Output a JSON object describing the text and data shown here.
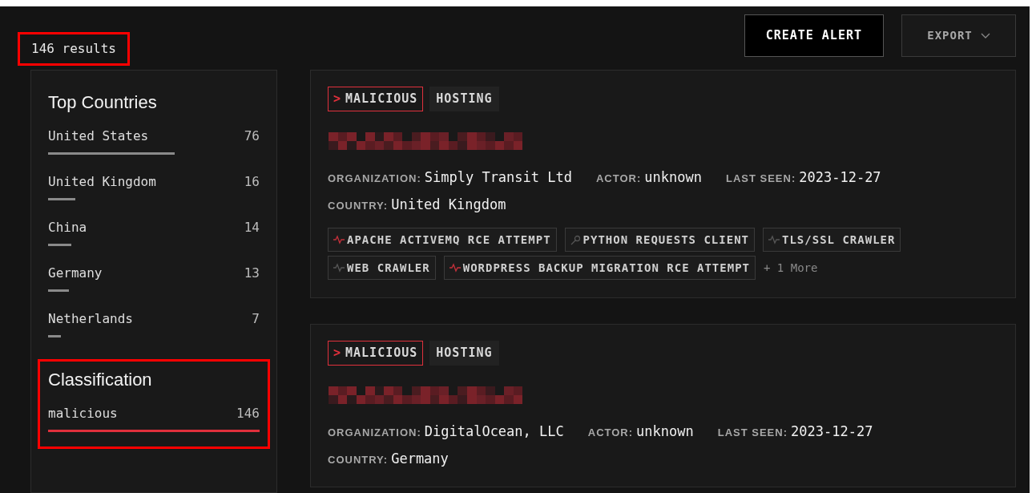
{
  "results_count": "146 results",
  "actions": [
    {
      "label": "CREATE ALERT",
      "kind": "primary"
    },
    {
      "label": "EXPORT",
      "kind": "dropdown"
    }
  ],
  "sidebar": {
    "sections": [
      {
        "title": "Top Countries",
        "highlighted": false,
        "items": [
          {
            "label": "United States",
            "count": "76",
            "level": 0.6,
            "color": "#8a8a8a"
          },
          {
            "label": "United Kingdom",
            "count": "16",
            "level": 0.13,
            "color": "#8a8a8a"
          },
          {
            "label": "China",
            "count": "14",
            "level": 0.11,
            "color": "#8a8a8a"
          },
          {
            "label": "Germany",
            "count": "13",
            "level": 0.1,
            "color": "#8a8a8a"
          },
          {
            "label": "Netherlands",
            "count": "7",
            "level": 0.06,
            "color": "#8a8a8a"
          }
        ]
      },
      {
        "title": "Classification",
        "highlighted": true,
        "items": [
          {
            "label": "malicious",
            "count": "146",
            "level": 1,
            "color": "#e0303c"
          }
        ]
      }
    ]
  },
  "results": [
    {
      "badges": [
        {
          "label": "MALICIOUS",
          "kind": "malicious",
          "prefix": ">"
        },
        {
          "label": "HOSTING",
          "kind": "plain"
        }
      ],
      "fields": [
        [
          {
            "label": "ORGANIZATION:",
            "value": "Simply Transit Ltd"
          },
          {
            "label": "ACTOR:",
            "value": "unknown"
          },
          {
            "label": "LAST SEEN:",
            "value": "2023-12-27"
          }
        ],
        [
          {
            "label": "COUNTRY:",
            "value": "United Kingdom"
          }
        ]
      ],
      "tags": [
        {
          "label": "APACHE ACTIVEMQ RCE ATTEMPT",
          "kind": "pulse",
          "color": "#c0303a"
        },
        {
          "label": "PYTHON REQUESTS CLIENT",
          "kind": "pin",
          "color": "#555555"
        },
        {
          "label": "TLS/SSL CRAWLER",
          "kind": "pulse",
          "color": "#555555"
        },
        {
          "label": "WEB CRAWLER",
          "kind": "pulse",
          "color": "#555555"
        },
        {
          "label": "WORDPRESS BACKUP MIGRATION RCE ATTEMPT",
          "kind": "pulse",
          "color": "#c0303a"
        }
      ],
      "more": "+ 1 More"
    },
    {
      "badges": [
        {
          "label": "MALICIOUS",
          "kind": "malicious",
          "prefix": ">"
        },
        {
          "label": "HOSTING",
          "kind": "plain"
        }
      ],
      "fields": [
        [
          {
            "label": "ORGANIZATION:",
            "value": "DigitalOcean, LLC"
          },
          {
            "label": "ACTOR:",
            "value": "unknown"
          },
          {
            "label": "LAST SEEN:",
            "value": "2023-12-27"
          }
        ],
        [
          {
            "label": "COUNTRY:",
            "value": "Germany"
          }
        ]
      ]
    }
  ]
}
